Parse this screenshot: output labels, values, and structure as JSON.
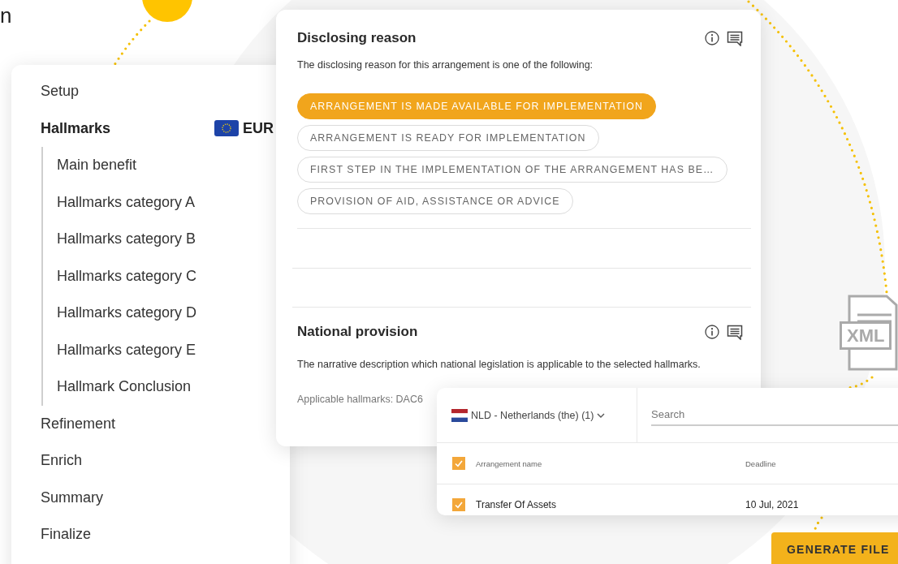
{
  "heading_fragment": "n",
  "steps": [
    {
      "label": "Setup",
      "selected": false
    },
    {
      "label": "Hallmarks",
      "selected": true,
      "currency": "EUR",
      "children": [
        {
          "label": "Main benefit",
          "selected": false
        },
        {
          "label": "Hallmarks category A",
          "selected": false
        },
        {
          "label": "Hallmarks category B",
          "selected": false
        },
        {
          "label": "Hallmarks category C",
          "selected": false
        },
        {
          "label": "Hallmarks category D",
          "selected": false
        },
        {
          "label": "Hallmarks category E",
          "selected": false
        },
        {
          "label": "Hallmark Conclusion",
          "selected": false
        }
      ]
    },
    {
      "label": "Refinement",
      "selected": false
    },
    {
      "label": "Enrich",
      "selected": false
    },
    {
      "label": "Summary",
      "selected": false
    },
    {
      "label": "Finalize",
      "selected": false
    }
  ],
  "disclosing_reason": {
    "title": "Disclosing reason",
    "description": "The disclosing reason for this arrangement is one of the following:",
    "options": [
      {
        "label": "ARRANGEMENT IS MADE AVAILABLE FOR IMPLEMENTATION",
        "selected": true
      },
      {
        "label": "ARRANGEMENT IS READY FOR IMPLEMENTATION",
        "selected": false
      },
      {
        "label": "FIRST STEP IN THE IMPLEMENTATION OF THE ARRANGEMENT HAS BE…",
        "selected": false
      },
      {
        "label": "PROVISION OF AID, ASSISTANCE OR ADVICE",
        "selected": false
      }
    ]
  },
  "national_provision": {
    "title": "National provision",
    "description": "The narrative description which national legislation is applicable to the selected hallmarks.",
    "applicable": "Applicable hallmarks: DAC6"
  },
  "arrangements": {
    "country": "NLD - Netherlands (the) (1)",
    "search": {
      "placeholder": "Search"
    },
    "all_checked": true,
    "columns": [
      "Arrangement name",
      "Deadline"
    ],
    "rows": [
      {
        "name": "Transfer Of Assets",
        "deadline": "10 Jul, 2021",
        "checked": true
      }
    ]
  },
  "file_badge": "XML",
  "generate_button": "GENERATE FILE"
}
